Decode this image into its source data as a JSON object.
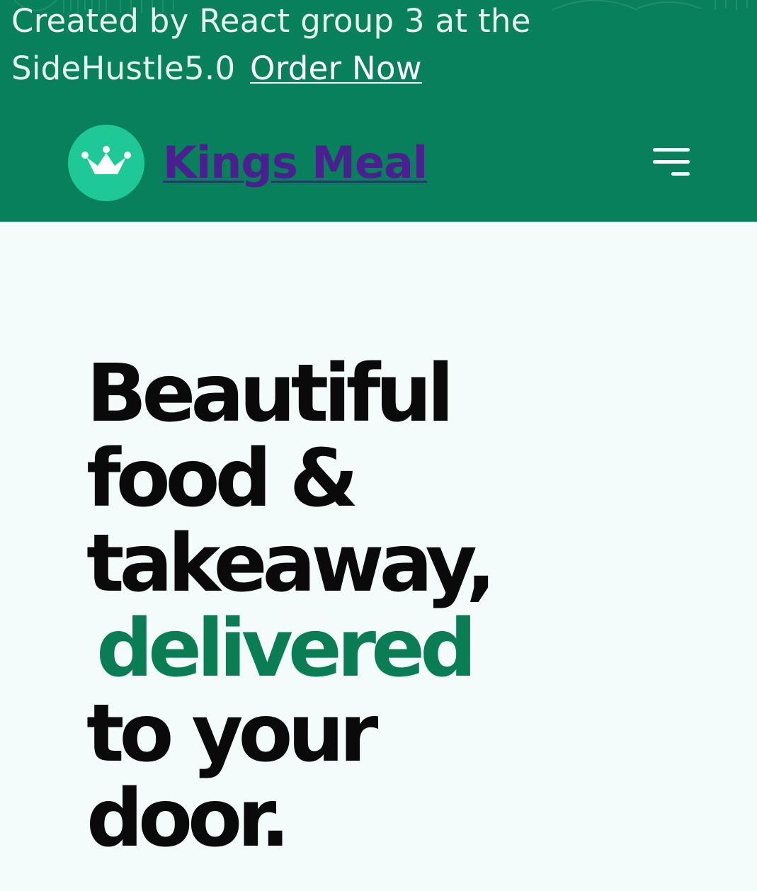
{
  "announcement": {
    "text_line1": "Created by React group 3 at the",
    "text_line2": "SideHustle5.0",
    "link_label": "Order Now"
  },
  "header": {
    "brand_name": "Kings Meal",
    "logo_icon": "crown-icon",
    "menu_icon": "hamburger-menu-icon"
  },
  "hero": {
    "line1": "Beautiful",
    "line2": "food &",
    "line3": "takeaway,",
    "line4_accent": "delivered",
    "line5": "to your",
    "line6": "door."
  },
  "colors": {
    "header_bg": "#08805b",
    "logo_bg": "#1fc997",
    "brand_text": "#4a1f8f",
    "accent": "#0b7d55",
    "page_bg": "#f3fbfb"
  }
}
